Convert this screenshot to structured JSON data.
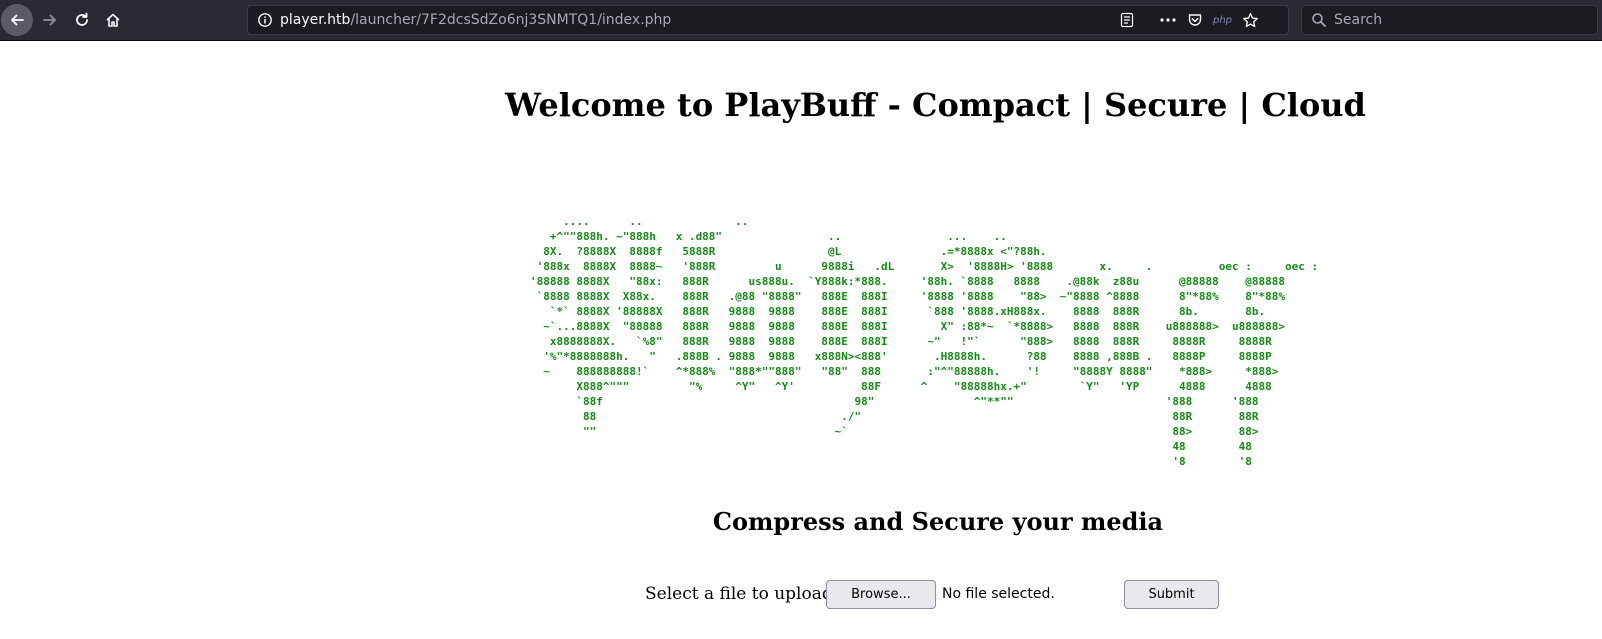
{
  "browser": {
    "url_host": "player.htb",
    "url_path": "/launcher/7F2dcsSdZo6nj3SNMTQ1/index.php",
    "search_placeholder": "Search",
    "php_badge": "php"
  },
  "page": {
    "title": "Welcome to PlayBuff - Compact | Secure | Cloud",
    "ascii_art": "     ....      ..              ..\n   +^\"\"888h. ~\"888h   x .d88\"                ..                ...    ..\n  8X.  ?8888X  8888f   5888R                 @L               .=*8888x <\"?88h.\n '888x  8888X  8888~   '888R         u      9888i   .dL       X>  '8888H> '8888       x.     .          oec :     oec :\n'88888 8888X   \"88x:   888R      us888u.  `Y888k:*888.     '88h. `8888   8888    .@88k  z88u      @88888    @88888\n `8888 8888X  X88x.    888R   .@88 \"8888\"   888E  888I     '8888 '8888    \"88>  ~\"8888 ^8888      8\"*88%    8\"*88%\n   `*` 8888X '88888X   888R   9888  9888    888E  888I      `888 '8888.xH888x.    8888  888R      8b.       8b.\n  ~`...8888X  \"88888   888R   9888  9888    888E  888I        X\" :88*~  `*8888>   8888  888R    u888888>  u888888>\n   x8888888X.   `%8\"   888R   9888  9888    888E  888I      ~\"   !\"`      \"888>   8888  888R     8888R     8888R\n  '%\"*8888888h.   \"   .888B . 9888  9888   x888N><888'       .H8888h.      ?88    8888 ,888B .   8888P     8888P\n  ~    888888888!`    ^*888%  \"888*\"\"888\"   \"88\"  888       :\"^\"88888h.    '!     \"8888Y 8888\"    *888>     *888>\n       X888^\"\"\"         \"%     ^Y\"   ^Y'          88F      ^    \"88888hx.+\"        `Y\"   'YP      4888      4888\n       `88f                                      98\"               ^\"**\"\"                       '888      '888\n        88                                     ./\"                                               88R       88R\n        \"\"                                    ~`                                                 88>       88>\n                                                                                                 48        48\n                                                                                                 '8        '8",
    "subtitle": "Compress and Secure your media",
    "upload_label": "Select a file to upload",
    "browse_label": "Browse...",
    "file_status": "No file selected.",
    "submit_label": "Submit"
  },
  "colors": {
    "toolbar_bg": "#2b2a33",
    "ascii_green": "#168a16"
  }
}
